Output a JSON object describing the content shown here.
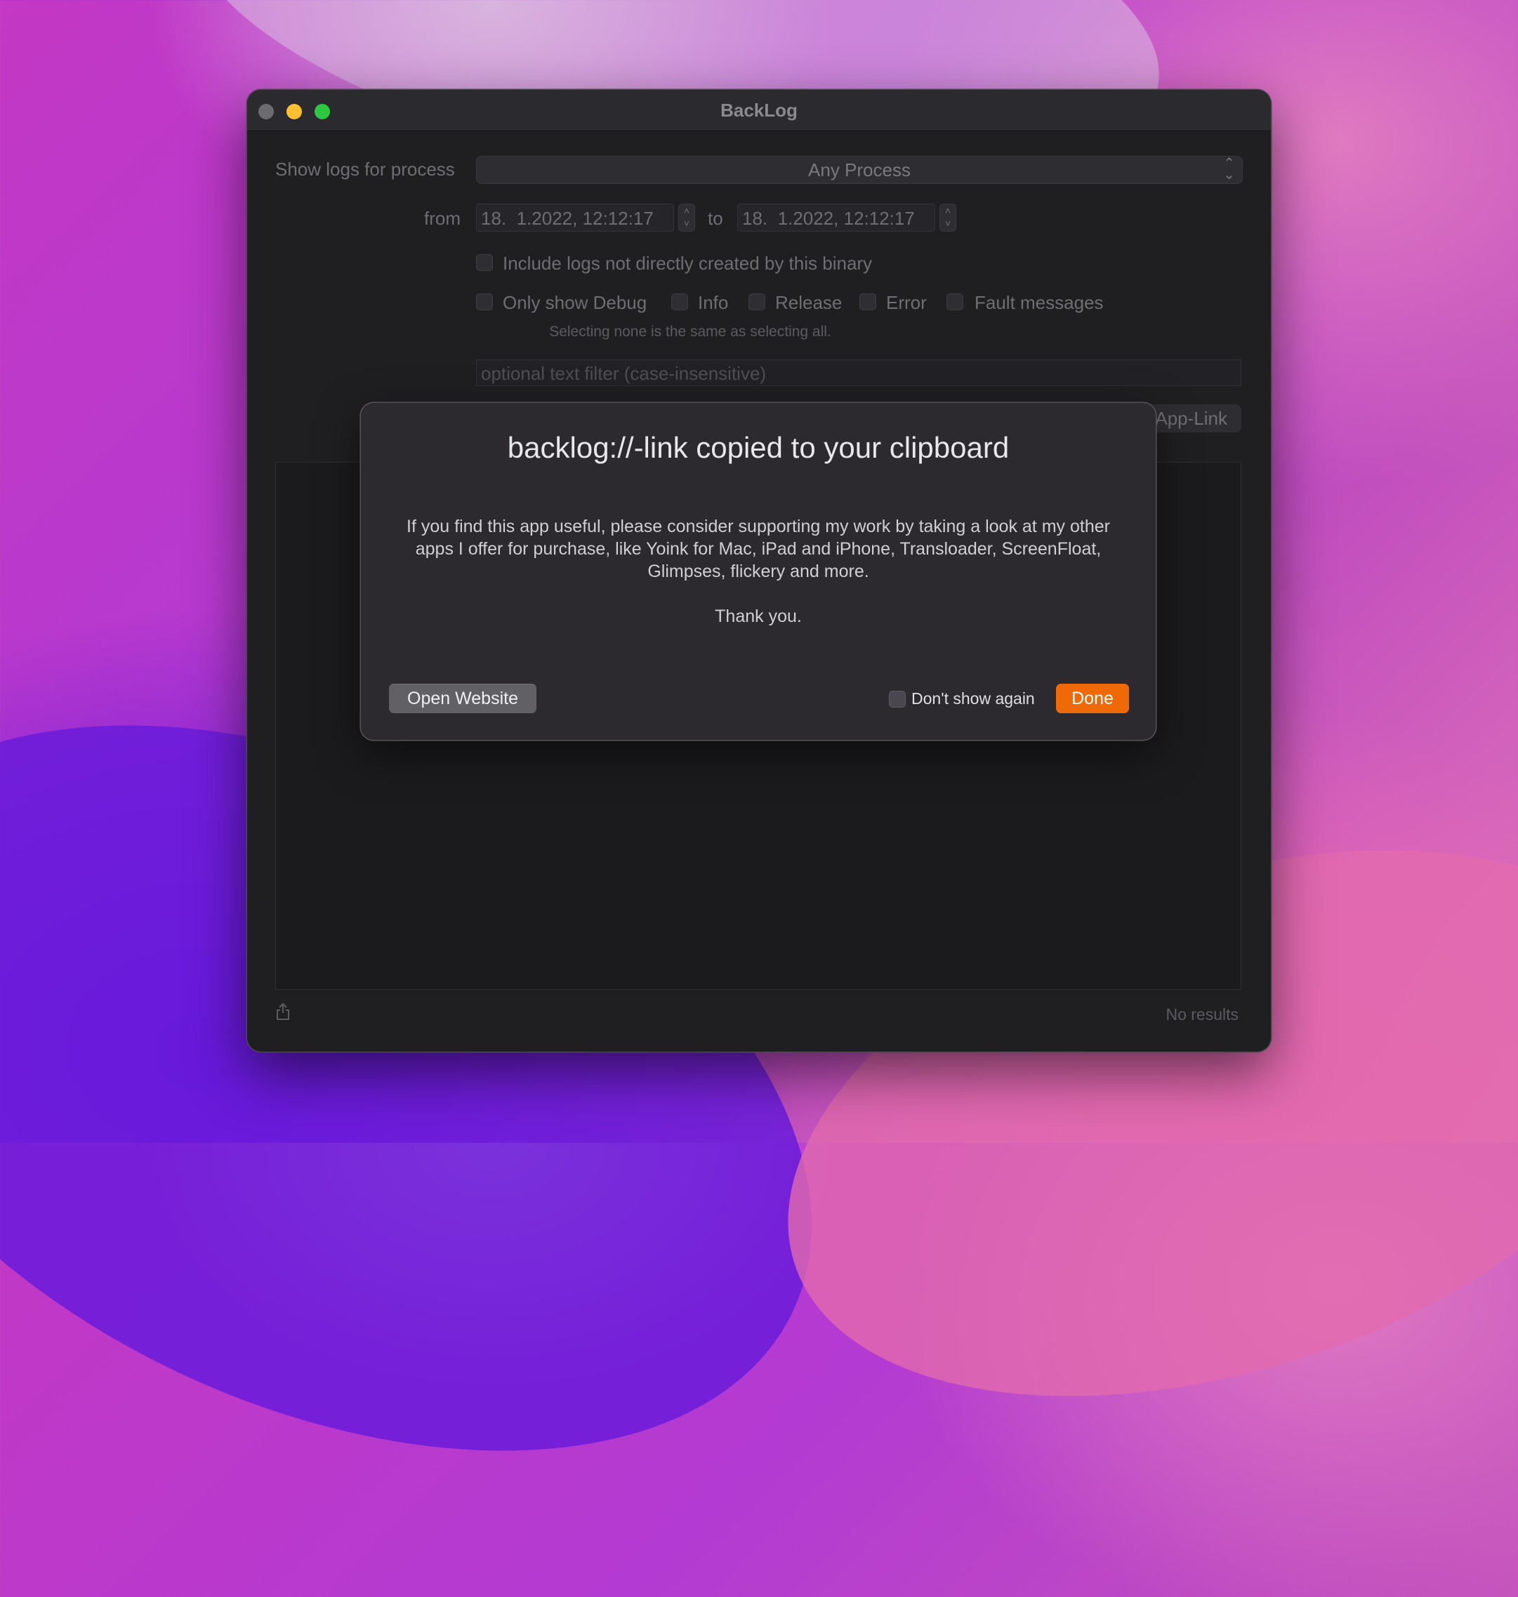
{
  "window": {
    "title": "BackLog",
    "process_label": "Show logs for process",
    "process_value": "Any Process",
    "from_label": "from",
    "to_label": "to",
    "from_value": "18.  1.2022, 12:12:17",
    "to_value": "18.  1.2022, 12:12:17",
    "include_label": "Include logs not directly created by this binary",
    "levels": [
      "Only show Debug",
      "Info",
      "Release",
      "Error",
      "Fault messages"
    ],
    "levels_hint": "Selecting none is the same as selecting all.",
    "filter_placeholder": "optional text filter (case-insensitive)",
    "applink_label": "App-Link",
    "status": "No results"
  },
  "dialog": {
    "title": "backlog://-link copied to your clipboard",
    "body": "If you find this app useful, please consider supporting my work by taking a look at my other apps I offer for purchase, like Yoink for Mac, iPad and iPhone, Transloader, ScreenFloat, Glimpses, flickery and more.",
    "thanks": "Thank you.",
    "open_website": "Open Website",
    "dont_show": "Don't show again",
    "done": "Done"
  },
  "colors": {
    "accent": "#ef6a06",
    "traffic_min": "#fec02f",
    "traffic_max": "#2dc840"
  }
}
